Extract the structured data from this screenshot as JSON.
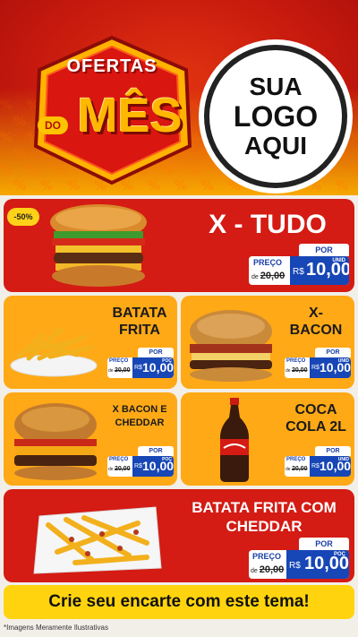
{
  "header": {
    "badge_top": "OFERTAS",
    "badge_do": "DO",
    "badge_main": "MÊS",
    "logo_placeholder": [
      "SUA",
      "LOGO",
      "AQUI"
    ],
    "pattern_glyph": "%"
  },
  "colors": {
    "red": "#d41b14",
    "orange": "#ffa916",
    "yellow": "#ffd40e",
    "blue": "#1746b6"
  },
  "products": [
    {
      "id": "x-tudo",
      "title_lines": [
        "X - TUDO"
      ],
      "badge": "-50%",
      "por": "POR",
      "preco_label": "PREÇO",
      "de": "de",
      "old_price": "20,00",
      "currency": "R$",
      "price": "10,00",
      "unit": "UNID",
      "icon": "burger-icon"
    },
    {
      "id": "batata-frita",
      "title_lines": [
        "BATATA",
        "FRITA"
      ],
      "por": "POR",
      "preco_label": "PREÇO",
      "de": "de",
      "old_price": "20,00",
      "currency": "R$",
      "price": "10,00",
      "unit": "POÇ",
      "icon": "fries-icon"
    },
    {
      "id": "x-bacon",
      "title_lines": [
        "X-",
        "BACON"
      ],
      "por": "POR",
      "preco_label": "PREÇO",
      "de": "de",
      "old_price": "20,00",
      "currency": "R$",
      "price": "10,00",
      "unit": "UNID",
      "icon": "burger-icon"
    },
    {
      "id": "x-bacon-cheddar",
      "title_lines": [
        "X BACON E",
        "CHEDDAR"
      ],
      "por": "POR",
      "preco_label": "PREÇO",
      "de": "de",
      "old_price": "20,00",
      "currency": "R$",
      "price": "10,00",
      "unit": "POÇ",
      "icon": "burger-icon"
    },
    {
      "id": "coca-cola",
      "title_lines": [
        "COCA",
        "COLA 2L"
      ],
      "por": "POR",
      "preco_label": "PREÇO",
      "de": "de",
      "old_price": "20,00",
      "currency": "R$",
      "price": "10,00",
      "unit": "UNID",
      "icon": "soda-bottle-icon"
    },
    {
      "id": "batata-cheddar",
      "title_lines": [
        "BATATA FRITA COM",
        "CHEDDAR"
      ],
      "por": "POR",
      "preco_label": "PREÇO",
      "de": "de",
      "old_price": "20,00",
      "currency": "R$",
      "price": "10,00",
      "unit": "POÇ",
      "icon": "fries-icon"
    }
  ],
  "cta": "Crie seu encarte com este tema!",
  "footnote": "*Imagens Meramente Ilustrativas"
}
